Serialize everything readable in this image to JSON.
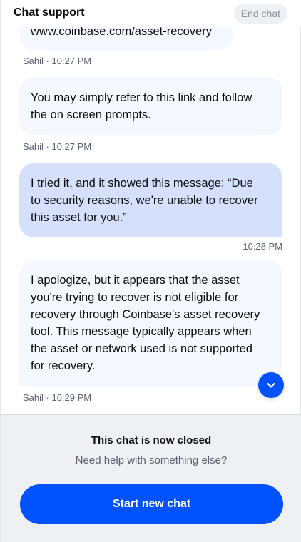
{
  "header": {
    "title": "Chat support",
    "end_chat_label": "End chat"
  },
  "messages": [
    {
      "sender": "agent",
      "text": "www.coinbase.com/asset-recovery",
      "meta": "Sahil · 10:27 PM"
    },
    {
      "sender": "agent",
      "lines": [
        "You may simply refer to this link and follow",
        "the on screen prompts."
      ],
      "meta": "Sahil · 10:27 PM"
    },
    {
      "sender": "user",
      "lines": [
        "I tried it, and it showed this message: “Due",
        "to security reasons, we're unable to recover",
        "this asset for you.”"
      ],
      "meta": "10:28 PM"
    },
    {
      "sender": "agent",
      "lines": [
        "I apologize, but it appears that the asset",
        "you're trying to recover is not eligible for",
        "recovery through Coinbase's asset recovery",
        "tool. This message typically appears when",
        "the asset or network used is not supported",
        "for recovery."
      ],
      "meta": "Sahil · 10:29 PM"
    }
  ],
  "scroll_button": {
    "icon": "chevron-down-icon"
  },
  "footer": {
    "closed_title": "This chat is now closed",
    "closed_subtitle": "Need help with something else?",
    "start_label": "Start new chat"
  },
  "colors": {
    "primary": "#0052ff",
    "agent_bubble": "#f5f8ff",
    "user_bubble": "#d5e1fc",
    "footer_bg": "#eef0f3"
  }
}
